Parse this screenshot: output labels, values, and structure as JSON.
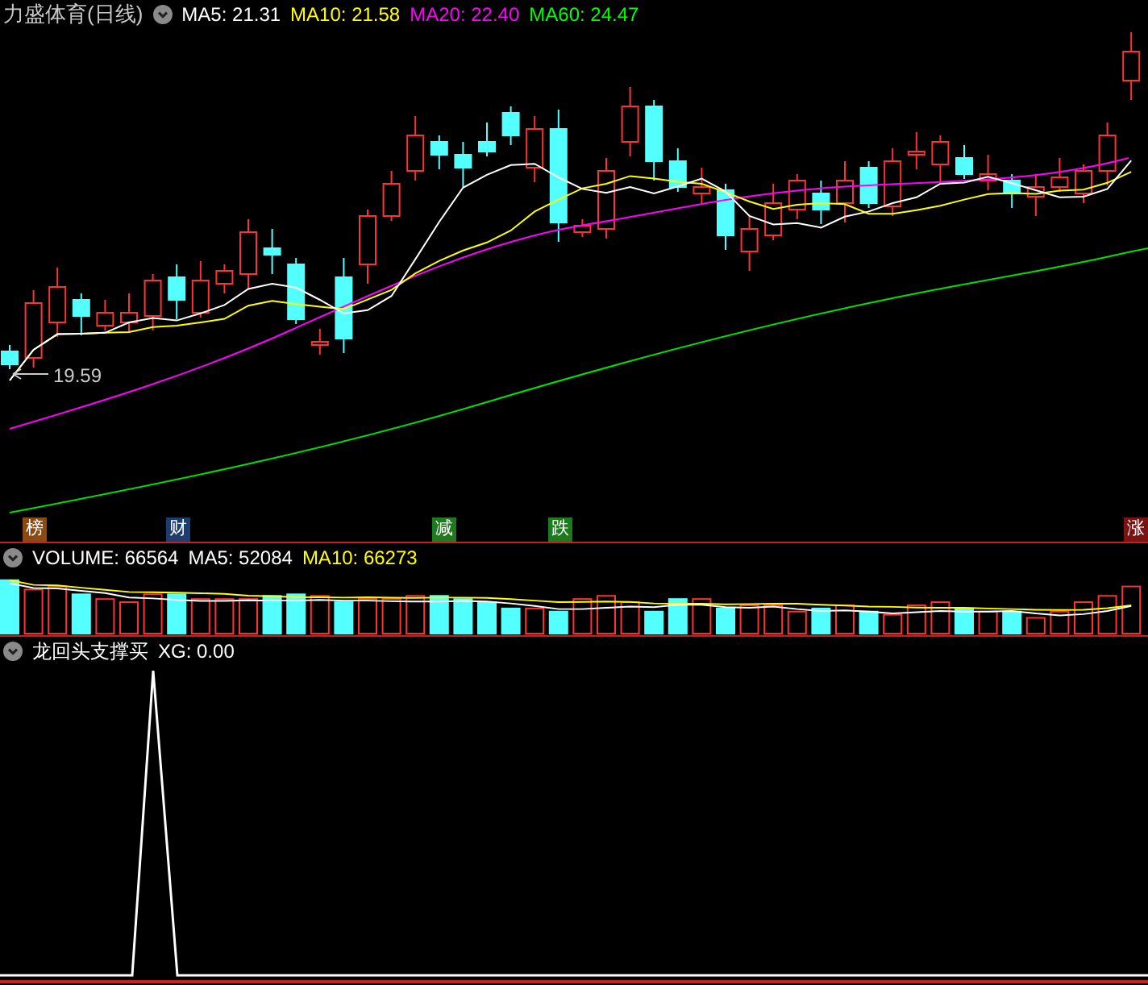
{
  "chart": {
    "title": "力盛体育(日线)",
    "indicators": [
      {
        "label": "MA5: 21.31",
        "color": "#ffffff"
      },
      {
        "label": "MA10: 21.58",
        "color": "#ffff00"
      },
      {
        "label": "MA20: 22.40",
        "color": "#ff00ff"
      },
      {
        "label": "MA60: 24.47",
        "color": "#00ff00"
      }
    ],
    "low_label": "19.59",
    "markers": [
      {
        "label": "榜",
        "color": "#8b4a14"
      },
      {
        "label": "财",
        "color": "#1c3d6e"
      },
      {
        "label": "减",
        "color": "#1e7a1e"
      },
      {
        "label": "跌",
        "color": "#1e7a1e"
      },
      {
        "label": "涨",
        "color": "#7a1414"
      }
    ]
  },
  "volume": {
    "indicators": [
      {
        "label": "VOLUME: 66564",
        "color": "#ffffff"
      },
      {
        "label": "MA5: 52084",
        "color": "#ffffff"
      },
      {
        "label": "MA10: 66273",
        "color": "#ffff00"
      }
    ]
  },
  "signal": {
    "indicators": [
      {
        "label": "龙回头支撑买",
        "color": "#ffffff"
      },
      {
        "label": "XG: 0.00",
        "color": "#ffffff"
      }
    ]
  }
}
